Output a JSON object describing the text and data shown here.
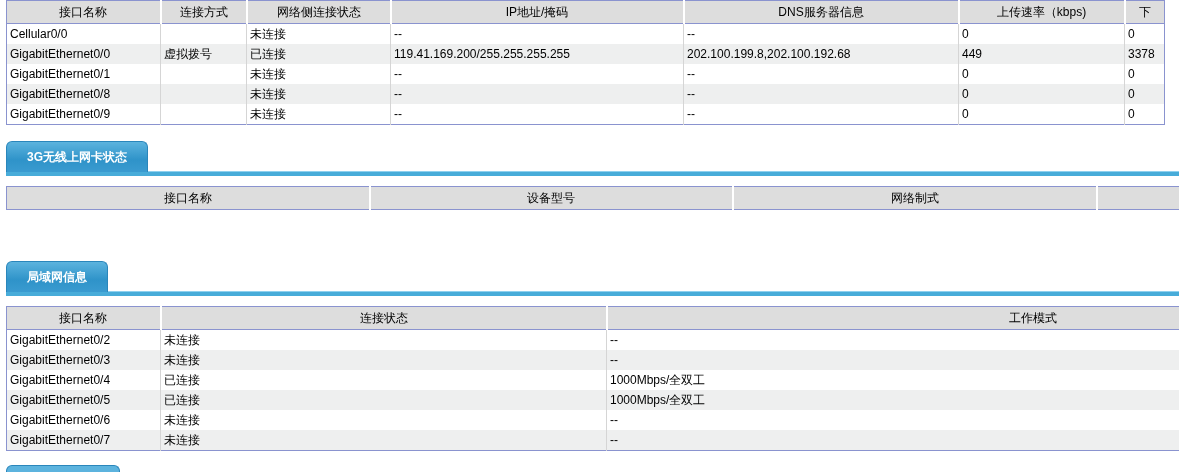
{
  "wan_table": {
    "columns": [
      "接口名称",
      "连接方式",
      "网络侧连接状态",
      "IP地址/掩码",
      "DNS服务器信息",
      "上传速率（kbps)",
      "下"
    ],
    "rows": [
      [
        "Cellular0/0",
        null,
        "未连接",
        "--",
        "--",
        "0",
        "0"
      ],
      [
        "GigabitEthernet0/0",
        "虚拟拨号",
        "已连接",
        "119.41.169.200/255.255.255.255",
        "202.100.199.8,202.100.192.68",
        "449",
        "3378"
      ],
      [
        "GigabitEthernet0/1",
        null,
        "未连接",
        "--",
        "--",
        "0",
        "0"
      ],
      [
        "GigabitEthernet0/8",
        null,
        "未连接",
        "--",
        "--",
        "0",
        "0"
      ],
      [
        "GigabitEthernet0/9",
        null,
        "未连接",
        "--",
        "--",
        "0",
        "0"
      ]
    ]
  },
  "sections": [
    {
      "title": "3G无线上网卡状态",
      "table": {
        "columns": [
          "接口名称",
          "设备型号",
          "网络制式"
        ]
      }
    },
    {
      "title": "局域网信息",
      "table": {
        "columns": [
          "接口名称",
          "连接状态",
          "工作模式"
        ],
        "rows": [
          [
            "GigabitEthernet0/2",
            "未连接",
            "--"
          ],
          [
            "GigabitEthernet0/3",
            "未连接",
            "--"
          ],
          [
            "GigabitEthernet0/4",
            "已连接",
            "1000Mbps/全双工"
          ],
          [
            "GigabitEthernet0/5",
            "已连接",
            "1000Mbps/全双工"
          ],
          [
            "GigabitEthernet0/6",
            "未连接",
            "--"
          ],
          [
            "GigabitEthernet0/7",
            "未连接",
            "--"
          ]
        ]
      }
    }
  ]
}
